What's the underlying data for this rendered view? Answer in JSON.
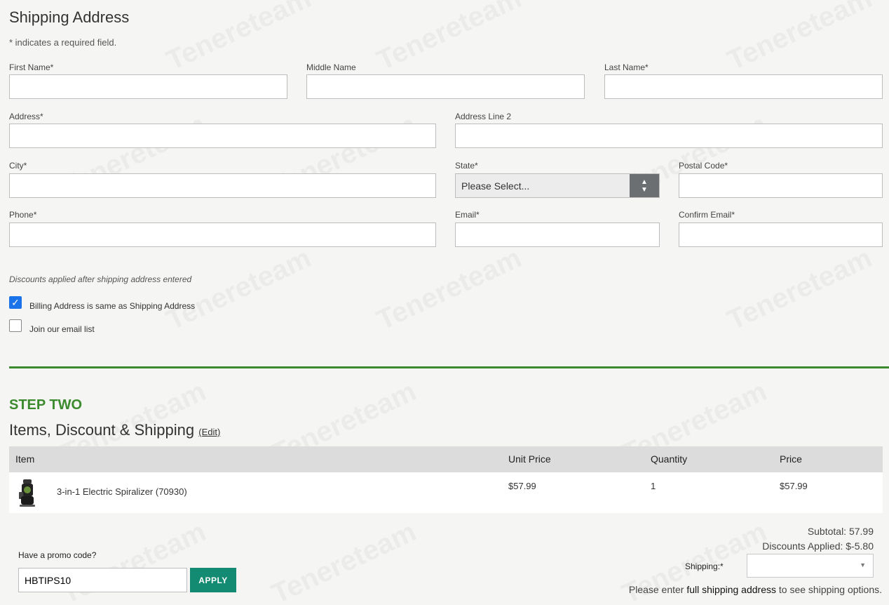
{
  "shipping": {
    "title": "Shipping Address",
    "required_note": "* indicates a required field.",
    "fields": {
      "first_name": "First Name*",
      "middle_name": "Middle Name",
      "last_name": "Last Name*",
      "address": "Address*",
      "address2": "Address Line 2",
      "city": "City*",
      "state": "State*",
      "postal": "Postal Code*",
      "phone": "Phone*",
      "email": "Email*",
      "confirm_email": "Confirm Email*"
    },
    "state_value": "Please Select...",
    "discount_note": "Discounts applied after shipping address entered",
    "billing_same_label": "Billing Address is same as Shipping Address",
    "billing_same_checked": true,
    "email_list_label": "Join our email list",
    "email_list_checked": false
  },
  "step_two": {
    "step_label": "STEP TWO",
    "title": "Items, Discount & Shipping",
    "edit_label": "(Edit)",
    "columns": [
      "Item",
      "Unit Price",
      "Quantity",
      "Price"
    ],
    "rows": [
      {
        "name": "3-in-1 Electric Spiralizer (70930)",
        "unit_price": "$57.99",
        "quantity": "1",
        "price": "$57.99"
      }
    ],
    "promo_label": "Have a promo code?",
    "promo_value": "HBTIPS10",
    "apply_label": "APPLY",
    "subtotal": "Subtotal: 57.99",
    "discounts": "Discounts Applied: $-5.80",
    "shipping_label": "Shipping:*",
    "shipping_note_pre": "Please enter ",
    "shipping_note_bold": "full shipping address",
    "shipping_note_post": " to see shipping options."
  },
  "colors": {
    "accent_green": "#3c8a2e",
    "apply_teal": "#138a72",
    "checkbox_blue": "#1a73e8"
  },
  "icons": {
    "state_arrows": "up-down-arrows-icon",
    "product_thumb": "spiralizer-icon",
    "ship_caret": "chevron-down-icon"
  }
}
